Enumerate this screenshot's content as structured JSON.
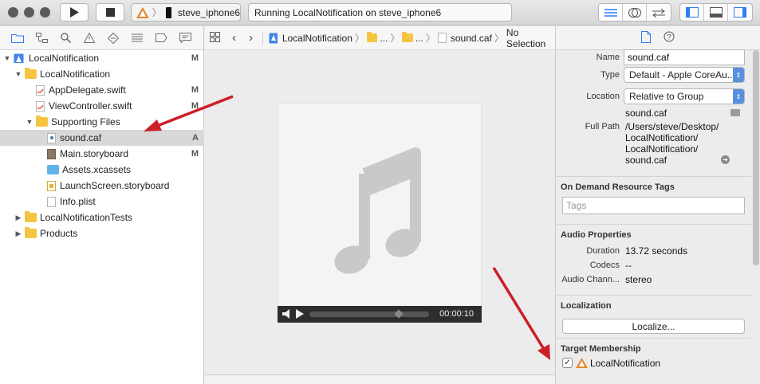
{
  "toolbar": {
    "scheme_target": "steve_iphone6",
    "status_text": "Running LocalNotification on steve_iphone6"
  },
  "navigator": {
    "items": [
      {
        "label": "LocalNotification",
        "badge": "M"
      },
      {
        "label": "LocalNotification",
        "badge": ""
      },
      {
        "label": "AppDelegate.swift",
        "badge": "M"
      },
      {
        "label": "ViewController.swift",
        "badge": "M"
      },
      {
        "label": "Supporting Files",
        "badge": ""
      },
      {
        "label": "sound.caf",
        "badge": "A"
      },
      {
        "label": "Main.storyboard",
        "badge": "M"
      },
      {
        "label": "Assets.xcassets",
        "badge": ""
      },
      {
        "label": "LaunchScreen.storyboard",
        "badge": ""
      },
      {
        "label": "Info.plist",
        "badge": ""
      },
      {
        "label": "LocalNotificationTests",
        "badge": ""
      },
      {
        "label": "Products",
        "badge": ""
      }
    ]
  },
  "jumpbar": {
    "project": "LocalNotification",
    "ellipsis1": "...",
    "ellipsis2": "...",
    "file": "sound.caf",
    "selection": "No Selection"
  },
  "player": {
    "time": "00:00:10"
  },
  "inspector": {
    "name_label": "Name",
    "name_value": "sound.caf",
    "type_label": "Type",
    "type_value": "Default - Apple CoreAu...",
    "location_label": "Location",
    "location_value": "Relative to Group",
    "location_file": "sound.caf",
    "fullpath_label": "Full Path",
    "fullpath_lines": [
      "/Users/steve/Desktop/",
      "LocalNotification/",
      "LocalNotification/",
      "sound.caf"
    ],
    "odr_title": "On Demand Resource Tags",
    "tags_placeholder": "Tags",
    "audio_title": "Audio Properties",
    "duration_label": "Duration",
    "duration_value": "13.72 seconds",
    "codecs_label": "Codecs",
    "codecs_value": "--",
    "channels_label": "Audio Chann...",
    "channels_value": "stereo",
    "localization_title": "Localization",
    "localize_button": "Localize...",
    "target_title": "Target Membership",
    "target_name": "LocalNotification"
  },
  "colors": {
    "annotation_arrow": "#cc1f26",
    "accent_blue": "#2f7cf6"
  }
}
